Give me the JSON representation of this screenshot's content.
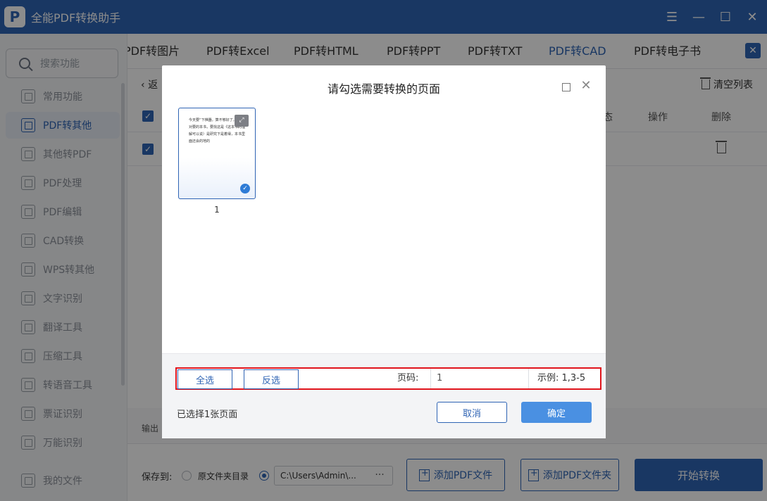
{
  "app": {
    "title": "全能PDF转换助手",
    "logo_letter": "P"
  },
  "window_controls": {
    "menu": "☰",
    "minimize": "—",
    "maximize": "☐",
    "close": "✕"
  },
  "search": {
    "placeholder": "搜索功能"
  },
  "sidebar": {
    "items": [
      {
        "label": "常用功能",
        "active": false
      },
      {
        "label": "PDF转其他",
        "active": true
      },
      {
        "label": "其他转PDF",
        "active": false
      },
      {
        "label": "PDF处理",
        "active": false
      },
      {
        "label": "PDF编辑",
        "active": false
      },
      {
        "label": "CAD转换",
        "active": false
      },
      {
        "label": "WPS转其他",
        "active": false
      },
      {
        "label": "文字识别",
        "active": false
      },
      {
        "label": "翻译工具",
        "active": false
      },
      {
        "label": "压缩工具",
        "active": false
      },
      {
        "label": "转语音工具",
        "active": false
      },
      {
        "label": "票证识别",
        "active": false
      },
      {
        "label": "万能识别",
        "active": false
      }
    ],
    "my_files": "我的文件"
  },
  "tabs": {
    "items": [
      "PDF转图片",
      "PDF转Excel",
      "PDF转HTML",
      "PDF转PPT",
      "PDF转TXT",
      "PDF转CAD",
      "PDF转电子书"
    ],
    "active": "PDF转CAD",
    "close": "✕"
  },
  "list": {
    "back": "返",
    "clear": "清空列表",
    "col_status": "态",
    "col_action": "操作",
    "col_delete": "删除",
    "check": "✓"
  },
  "output": {
    "label": "输出"
  },
  "bottom": {
    "save_to": "保存到:",
    "option_source": "原文件夹目录",
    "path": "C:\\Users\\Admin\\...",
    "path_more": "···",
    "add_pdf": "添加PDF文件",
    "add_folder": "添加PDF文件夹",
    "start": "开始转换"
  },
  "dialog": {
    "title": "请勾选需要转换的页面",
    "close": "✕",
    "thumbnail": {
      "page_number": "1",
      "preview_text": "今天要“下棋器，算不够好了，读读对要的本书，要找这是《这本书的理解可以说）是研究下是着得，本书里面还会的地的",
      "zoom": "⤢",
      "check": "✓"
    },
    "select_all": "全选",
    "invert": "反选",
    "page_label": "页码:",
    "page_value": "1",
    "example": "示例: 1,3-5",
    "selected_count": "已选择1张页面",
    "cancel": "取消",
    "confirm": "确定"
  }
}
